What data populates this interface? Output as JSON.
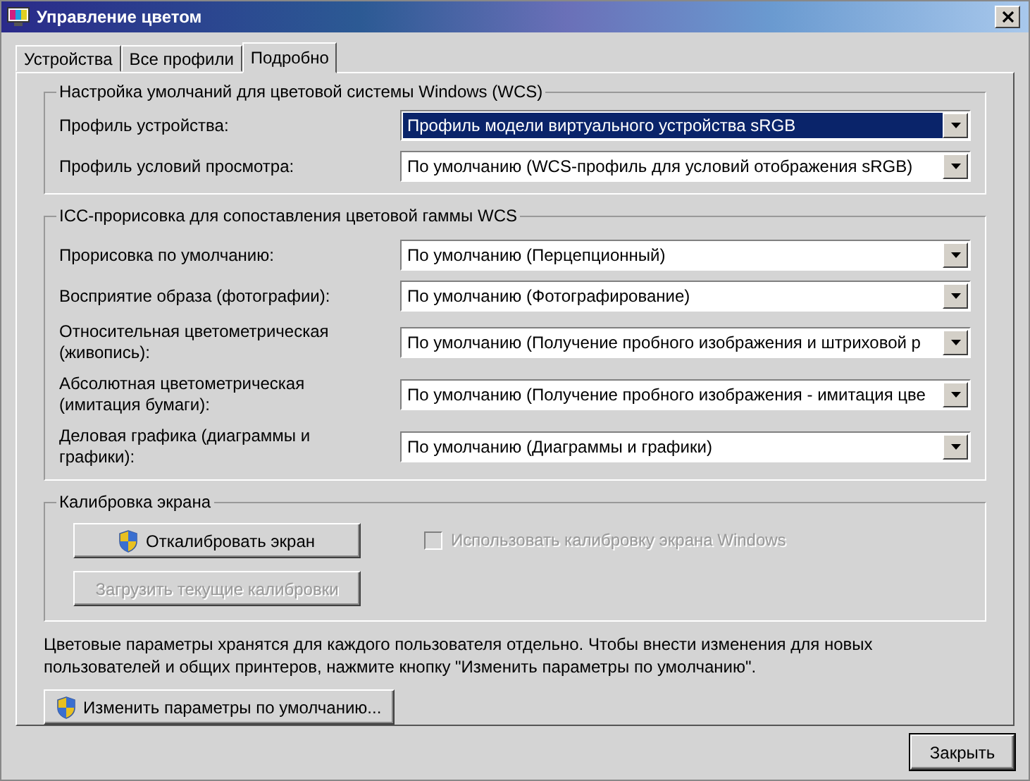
{
  "window": {
    "title": "Управление цветом"
  },
  "tabs": [
    {
      "label": "Устройства",
      "selected": false
    },
    {
      "label": "Все профили",
      "selected": false
    },
    {
      "label": "Подробно",
      "selected": true
    }
  ],
  "groups": [
    {
      "title": "Настройка умолчаний для цветовой системы Windows (WCS)",
      "rows": [
        {
          "label": "Профиль устройства:",
          "value": "Профиль модели виртуального устройства sRGB",
          "highlighted": true
        },
        {
          "label": "Профиль условий просмотра:",
          "value": "По умолчанию (WCS-профиль для условий отображения sRGB)",
          "highlighted": false
        }
      ]
    },
    {
      "title": "ICC-прорисовка для сопоставления цветовой гаммы WCS",
      "rows": [
        {
          "label": "Прорисовка по умолчанию:",
          "value": "По умолчанию (Перцепционный)",
          "highlighted": false
        },
        {
          "label": "Восприятие образа (фотографии):",
          "value": "По умолчанию (Фотографирование)",
          "highlighted": false
        },
        {
          "label": "Относительная цветометрическая (живопись):",
          "value": "По умолчанию (Получение пробного изображения и штриховой р",
          "highlighted": false
        },
        {
          "label": "Абсолютная цветометрическая (имитация бумаги):",
          "value": "По умолчанию (Получение пробного изображения - имитация цве",
          "highlighted": false
        },
        {
          "label": "Деловая графика (диаграммы и графики):",
          "value": "По умолчанию (Диаграммы и графики)",
          "highlighted": false
        }
      ]
    }
  ],
  "calibration": {
    "title": "Калибровка экрана",
    "buttons": [
      {
        "label": "Откалибровать экран",
        "shield": true,
        "disabled": false
      },
      {
        "label": "Загрузить текущие калибровки",
        "shield": false,
        "disabled": true
      }
    ],
    "checkbox": {
      "label": "Использовать калибровку экрана Windows",
      "checked": false,
      "disabled": true
    }
  },
  "info": "Цветовые параметры хранятся для каждого пользователя отдельно. Чтобы внести изменения для новых пользователей и общих принтеров, нажмите кнопку \"Изменить параметры по умолчанию\".",
  "defaults_button": {
    "label": "Изменить параметры по умолчанию...",
    "shield": true
  },
  "close_button": "Закрыть"
}
